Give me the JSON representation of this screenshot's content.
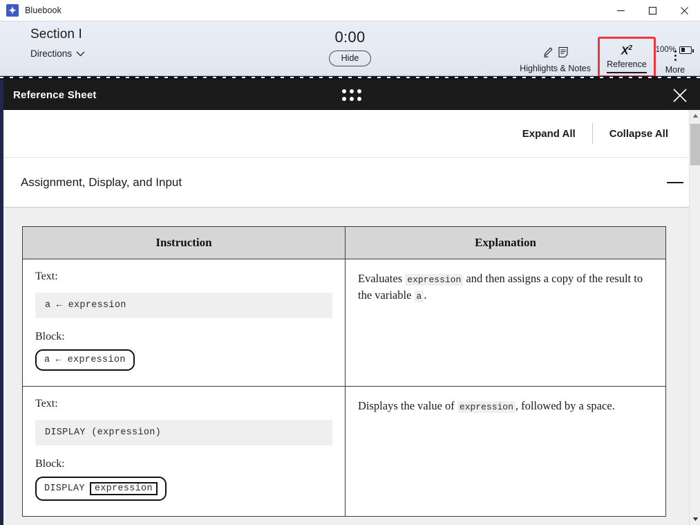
{
  "window": {
    "app_title": "Bluebook",
    "logo_glyph": "✦",
    "controls": {
      "minimize": "minimize-icon",
      "maximize": "maximize-icon",
      "close": "close-icon"
    }
  },
  "exam_toolbar": {
    "section_title": "Section I",
    "directions_label": "Directions",
    "directions_chevron": "chevron-down-icon",
    "timer": "0:00",
    "hide_label": "Hide",
    "tools": [
      {
        "id": "highlights-notes",
        "label": "Highlights & Notes",
        "icons": [
          "highlighter-icon",
          "note-icon"
        ],
        "active": true,
        "outlined": false
      },
      {
        "id": "reference",
        "label": "Reference",
        "icons": [
          "x-squared-icon"
        ],
        "active": true,
        "outlined": true
      },
      {
        "id": "more",
        "label": "More",
        "icons": [
          "kebab-menu-icon"
        ],
        "active": false,
        "outlined": false
      }
    ],
    "zoom_percent": "100%",
    "battery_icon": "battery-icon",
    "highlight_color": "#f0363c"
  },
  "reference_sheet": {
    "title": "Reference Sheet",
    "drag_handle_icon": "drag-dots-icon",
    "close_icon": "close-icon",
    "expand_all_label": "Expand All",
    "collapse_all_label": "Collapse All",
    "accordion": {
      "title": "Assignment, Display, and Input",
      "toggle_icon": "minus-icon",
      "expanded": true
    },
    "table": {
      "headers": [
        "Instruction",
        "Explanation"
      ],
      "rows": [
        {
          "text_label": "Text:",
          "text_code": "a ← expression",
          "block_label": "Block:",
          "block_code_prefix": "a ← expression",
          "block_code_slot": "",
          "explanation_parts": [
            {
              "type": "text",
              "value": "Evaluates "
            },
            {
              "type": "code",
              "value": "expression"
            },
            {
              "type": "text",
              "value": " and then assigns a copy of the result to the variable "
            },
            {
              "type": "code",
              "value": "a"
            },
            {
              "type": "text",
              "value": "."
            }
          ]
        },
        {
          "text_label": "Text:",
          "text_code": "DISPLAY (expression)",
          "block_label": "Block:",
          "block_code_prefix": "DISPLAY",
          "block_code_slot": "expression",
          "explanation_parts": [
            {
              "type": "text",
              "value": "Displays the value of "
            },
            {
              "type": "code",
              "value": "expression"
            },
            {
              "type": "text",
              "value": ", followed by a space."
            }
          ]
        }
      ]
    },
    "scrollbar": {
      "up_icon": "caret-up-icon",
      "down_icon": "caret-down-icon"
    }
  }
}
